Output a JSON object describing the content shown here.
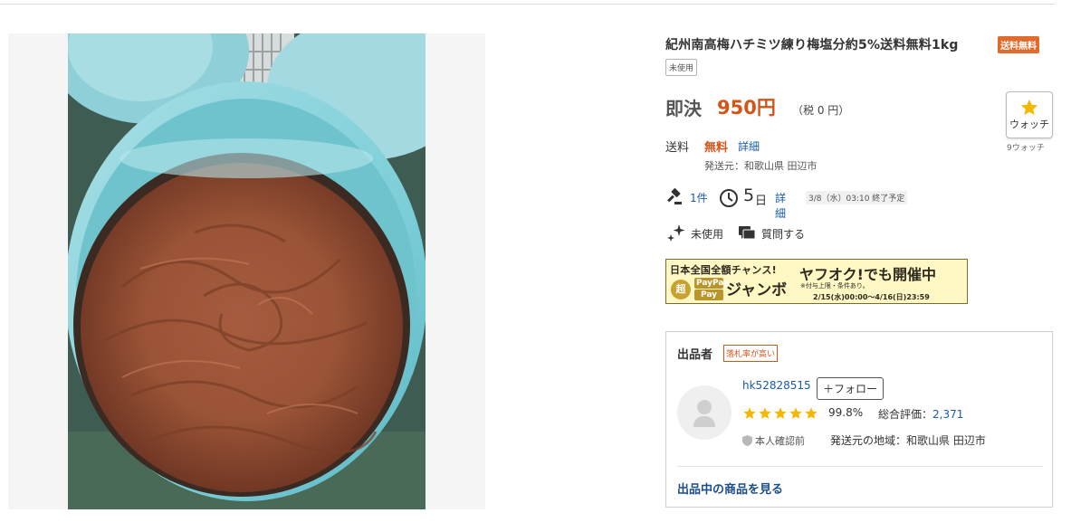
{
  "product": {
    "title": "紀州南高梅ハチミツ練り梅塩分約5%送料無料1kg",
    "shipping_badge": "送料無料",
    "condition_badge": "未使用",
    "image_alt": "light blue bucket filled with pureed plum paste"
  },
  "price": {
    "label": "即決",
    "value": "950円",
    "tax_note": "（税 0 円）"
  },
  "watch": {
    "label": "ウォッチ",
    "count_text": "9ウォッチ"
  },
  "shipping": {
    "label": "送料",
    "value": "無料",
    "detail_link": "詳細",
    "origin": "発送元：和歌山県 田辺市"
  },
  "bids": {
    "count": "1件",
    "days_num": "5",
    "days_unit": "日",
    "detail_link": "詳細",
    "end_date": "3/8（水）03:10 終了予定"
  },
  "condition": {
    "text": "未使用",
    "ask_link": "質問する"
  },
  "banner": {
    "line1": "日本全国全額チャンス!",
    "headline": "ヤフオク!でも開催中",
    "circle": "超",
    "paypay1": "PayPay",
    "paypay2": "Pay",
    "jumbo": "ジャンボ",
    "note": "※付与上限・条件あり。",
    "period": "2/15(水)00:00〜4/16(日)23:59"
  },
  "seller": {
    "heading": "出品者",
    "badge": "落札率が高い",
    "id": "hk52828515",
    "follow_label": "＋フォロー",
    "stars": 5,
    "rating_percent": "99.8%",
    "total_label": "総合評価：",
    "total_value": "2,371",
    "verified": "本人確認前",
    "location": "発送元の地域：和歌山県 田辺市",
    "items_link": "出品中の商品を見る"
  },
  "colors": {
    "accent_orange": "#d4541a",
    "link_blue": "#1a5aa8",
    "star_yellow": "#f5b800",
    "banner_bg": "#fff7c4"
  },
  "icons": [
    "gavel-icon",
    "clock-icon",
    "sparkle-icon",
    "chat-icon",
    "star-icon",
    "avatar-icon",
    "shield-icon"
  ]
}
